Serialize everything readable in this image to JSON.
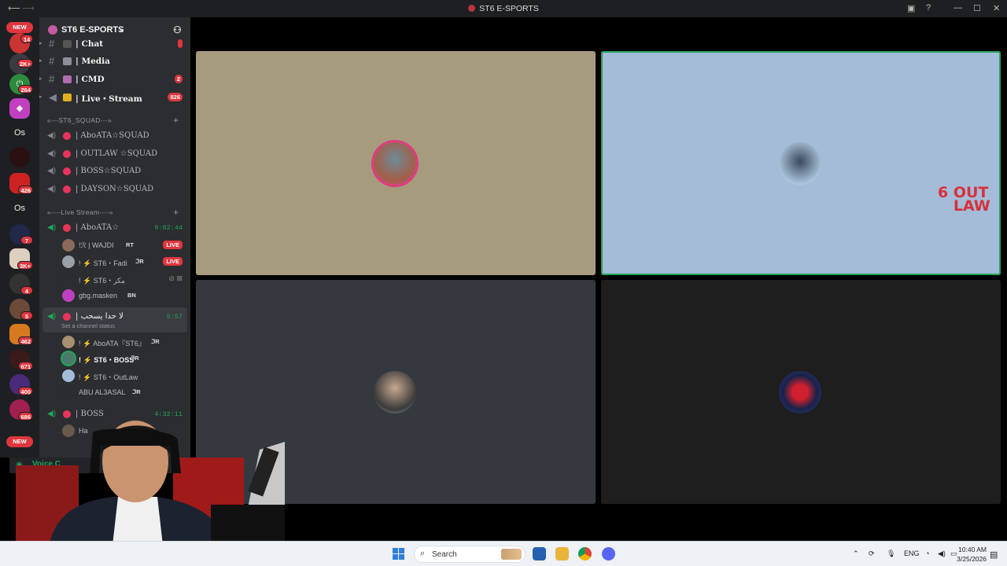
{
  "window": {
    "title": "ST6 E-SPORTS",
    "back_icon": "arrow-left-icon",
    "forward_icon": "arrow-right-icon"
  },
  "server_rail": {
    "badges": [
      "14",
      "2K+",
      "264",
      "426",
      "7",
      "3K+",
      "4",
      "5",
      "462",
      "671",
      "400",
      "686"
    ],
    "new_label": "NEW",
    "text_servers": [
      "Os",
      "Os"
    ]
  },
  "server": {
    "name": "ST6 E-SPORTS"
  },
  "text_channels": [
    {
      "name": "| Chat",
      "badge": ""
    },
    {
      "name": "| Media",
      "badge": ""
    },
    {
      "name": "| CMD",
      "badge": "2"
    },
    {
      "name": "| Live・Stream",
      "badge": "826"
    }
  ],
  "categories": {
    "squad": "«---ST6_SQUAD---»",
    "live": "«----Live Stream----»"
  },
  "squad_channels": [
    "| AboATA☆SQUAD",
    "| OUTLAW ☆SQUAD",
    "| BOSS☆SQUAD",
    "| DAYSON☆SQUAD"
  ],
  "live_channels": [
    {
      "name": "| AboATA☆",
      "timer": "9:02:44",
      "members": [
        {
          "name": "!ℛ | WAJDI",
          "tag": "RT",
          "live": "LIVE"
        },
        {
          "name": "! ⚡ ST6・Fadi",
          "tag": "ℑR",
          "live": "LIVE"
        },
        {
          "name": "! ⚡ ST6・مكر",
          "tag": "",
          "live": ""
        },
        {
          "name": "gbg.masken",
          "tag": "BN",
          "live": ""
        }
      ]
    },
    {
      "name": "| لا حدا يسحب",
      "timer": "5:57",
      "status": "Set a channel status",
      "members": [
        {
          "name": "! ⚡ AboATA『ST6』",
          "tag": "ℑR"
        },
        {
          "name": "! ⚡ ST6・BOSS",
          "tag": "ℑR"
        },
        {
          "name": "! ⚡ ST6・OutLaw",
          "tag": ""
        },
        {
          "name": "ABU AL3ASAL",
          "tag": "ℑR"
        }
      ]
    },
    {
      "name": "| BOSS",
      "timer": "4:32:11",
      "members": [
        {
          "name": "Ha",
          "tag": ""
        }
      ]
    }
  ],
  "voice_connected": "Voice C",
  "tiles": [
    {
      "bg": "#a69c7d",
      "avatar": "user-avatar-1"
    },
    {
      "bg": "#a4bcd8",
      "avatar": "user-avatar-2",
      "watermark": "OUT LAW"
    },
    {
      "bg": "#33393f",
      "avatar": "user-avatar-3"
    },
    {
      "bg": "#1e1e1f",
      "avatar": "user-avatar-4"
    }
  ],
  "taskbar": {
    "search_placeholder": "Search",
    "lang": "ENG",
    "time": "10:40 AM",
    "date": "3/25/2026"
  },
  "colors": {
    "accent_green": "#23a55a",
    "badge_red": "#e0363e",
    "sidebar": "#2b2d31",
    "rail": "#1e1f22"
  }
}
